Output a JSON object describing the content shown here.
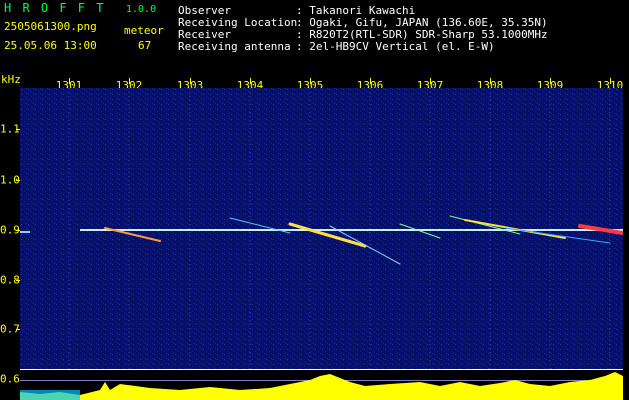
{
  "header": {
    "app_title": "H R O F F T",
    "version": "1.0.0",
    "filename": "2505061300.png",
    "detector_label": "meteor",
    "datetime": "25.05.06 13:00",
    "count": "67",
    "observer_label": "Observer",
    "observer_value": ": Takanori Kawachi",
    "location_label": "Receiving Location",
    "location_value": ": Ogaki, Gifu, JAPAN (136.60E, 35.35N)",
    "receiver_label": "Receiver",
    "receiver_value": ": R820T2(RTL-SDR) SDR-Sharp 53.1000MHz",
    "antenna_label": "Receiving antenna",
    "antenna_value": ": 2el-HB9CV Vertical (el. E-W)"
  },
  "axes": {
    "unit": "kHz",
    "x_ticks": [
      "1301",
      "1302",
      "1303",
      "1304",
      "1305",
      "1306",
      "1307",
      "1308",
      "1309",
      "1310"
    ],
    "y_ticks": [
      "1.1",
      "1.0",
      "0.9",
      "0.8",
      "0.7",
      "0.6"
    ]
  },
  "colors": {
    "label": "#ffff00",
    "text": "#ffffff",
    "title": "#00ff44",
    "background": "#000000",
    "spectrum": "#05105a"
  }
}
